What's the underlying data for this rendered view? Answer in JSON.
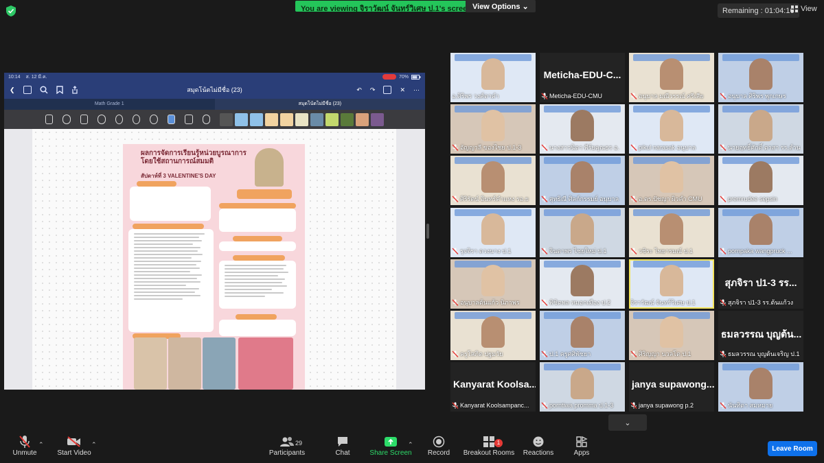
{
  "top": {
    "viewing_banner": "You are viewing จิราวัฒน์ จันทร์วิเศษ ป.1's screen",
    "view_options": "View Options",
    "remaining": "Remaining : 01:04:16",
    "view": "View"
  },
  "shared_screen": {
    "time": "10:14",
    "date": "ส. 12 มี.ค.",
    "battery": "70%",
    "notebook_title": "สมุดโน้ตไม่มีชื่อ (23)",
    "tabs": [
      "Math Grade 1",
      "สมุดโน้ตไม่มีชื่อ (23)"
    ],
    "poster": {
      "title": "ผลการจัดการเรียนรู้หน่วยบูรณาการ โดยใช้สถานการณ์สมมติ",
      "subtitle": "สัปดาห์ที่ 3 VALENTINE'S DAY"
    }
  },
  "gallery": [
    {
      "name": "อ.ศิริพร วงศ์ตาคำ",
      "kind": "video",
      "muted": false
    },
    {
      "name": "Meticha-EDU-CMU",
      "kind": "name",
      "display": "Meticha-EDU-C...",
      "muted": true
    },
    {
      "name": "อนุบาล มณีวรรณ์ ศรีเสีย",
      "kind": "video",
      "muted": true
    },
    {
      "name": "อนุบาล ศิริพร พุกเกษร",
      "kind": "video",
      "muted": true
    },
    {
      "name": "อัญญาลี ของไชย ป.1-3",
      "kind": "video",
      "muted": true
    },
    {
      "name": "นางสาวนิดา พีร์ยคุณธร อ.",
      "kind": "video",
      "muted": true
    },
    {
      "name": "pikul narasak อนุบาล",
      "kind": "video",
      "muted": true
    },
    {
      "name": "นายฤทธิ์ศักดิ์ ตาสา รร.ลำน",
      "kind": "video",
      "muted": true
    },
    {
      "name": "ศิริรัตน์ อินทร์คำแหง รอ.ย",
      "kind": "video",
      "muted": true
    },
    {
      "name": "สุทธิณี ศิลก์กรรมย์ อนุบาล",
      "kind": "video",
      "muted": true
    },
    {
      "name": "อ.ดร.ปัชญา ผิวคำ CMU",
      "kind": "video",
      "muted": true
    },
    {
      "name": "premrudee sepsin",
      "kind": "video",
      "muted": true
    },
    {
      "name": "รุจจิรา ดวงนาง ป.1",
      "kind": "video",
      "muted": true
    },
    {
      "name": "จินดาพร ไชยใหม่ ป.1",
      "kind": "video",
      "muted": true
    },
    {
      "name": "วชิระ ไพยารมณ์ ป.1",
      "kind": "video",
      "muted": true
    },
    {
      "name": "pornpaka wangpruck ...",
      "kind": "video",
      "muted": true
    },
    {
      "name": "อนุบาลต้นแก้ว นิภาพร",
      "kind": "video",
      "muted": true
    },
    {
      "name": "พิชิตพล หมอกเมือง ป.2",
      "kind": "video",
      "muted": true
    },
    {
      "name": "จิราวัฒน์ จันทร์วิเศษ ป.1",
      "kind": "video",
      "muted": false,
      "active": true
    },
    {
      "name": "สุภจิรา ป1-3 รร.ต้นแก้วง",
      "kind": "name",
      "display": "สุภจิรา ป1-3 รร...",
      "muted": true
    },
    {
      "name": "ครูโสภิต ปฐมวัย",
      "kind": "video",
      "muted": true
    },
    {
      "name": "ป.1 ครูศศิพัชยา",
      "kind": "video",
      "muted": true
    },
    {
      "name": "ศิริญญา นวลโต ป.1",
      "kind": "video",
      "muted": true
    },
    {
      "name": "ธมลวรรณ บุญต้นเจริญ ป.1",
      "kind": "name",
      "display": "ธมลวรรณ บุญต้น...",
      "muted": true
    },
    {
      "name": "Kanyarat Koolsampanc...",
      "kind": "name",
      "display": "Kanyarat Koolsa...",
      "muted": true
    },
    {
      "name": "porntiwa promma ป.1-3",
      "kind": "video",
      "muted": true
    },
    {
      "name": "janya supawong p.2",
      "kind": "name",
      "display": "janya supawong...",
      "muted": true
    },
    {
      "name": "นันทิดา สมหมาย",
      "kind": "video",
      "muted": true
    }
  ],
  "toolbar": {
    "unmute": "Unmute",
    "start_video": "Start Video",
    "participants": "Participants",
    "participants_count": "29",
    "chat": "Chat",
    "share_screen": "Share Screen",
    "record": "Record",
    "breakout_rooms": "Breakout Rooms",
    "breakout_badge": "1",
    "reactions": "Reactions",
    "apps": "Apps",
    "leave_room": "Leave Room"
  },
  "colors": {
    "banner_green": "#24c55a",
    "share_green": "#2ddc6a",
    "leave_blue": "#0e71eb",
    "active_outline": "#f3e45d",
    "muted_red": "#e53935"
  }
}
